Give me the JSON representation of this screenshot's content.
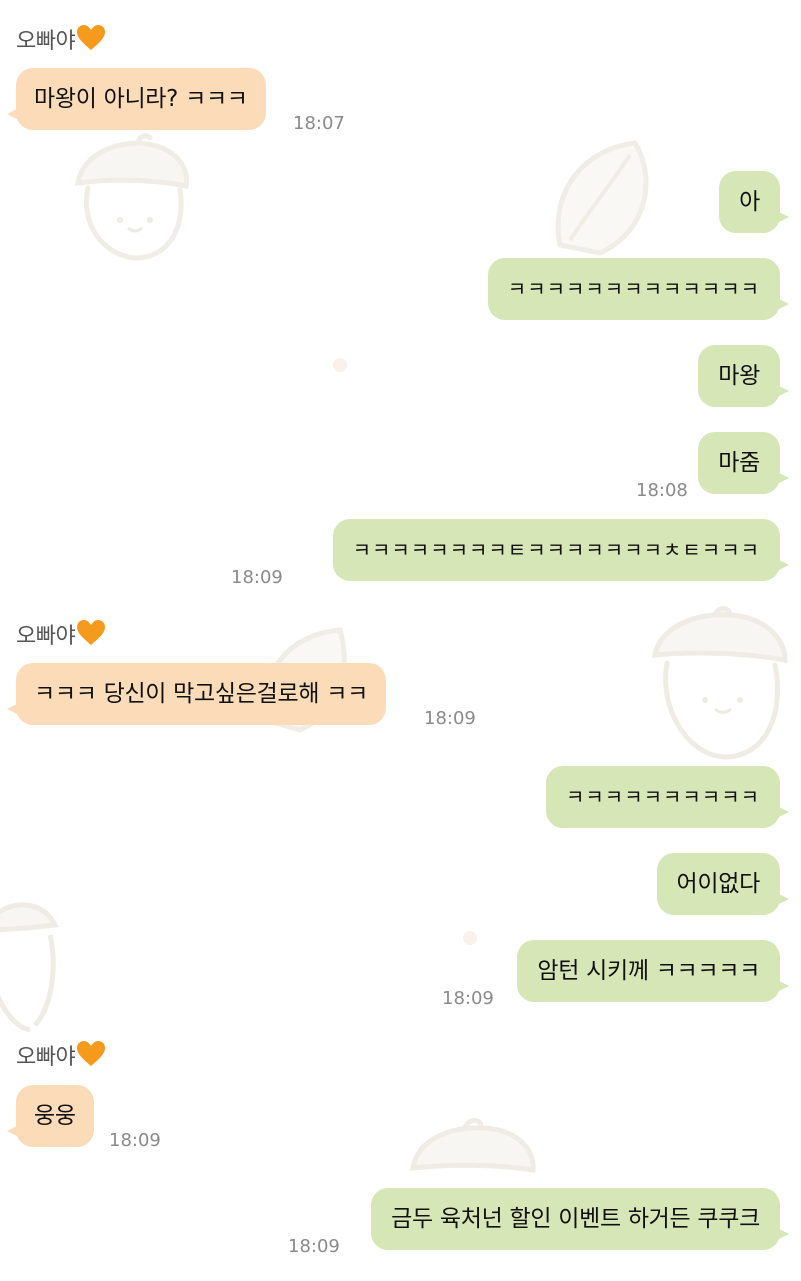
{
  "messages": [
    {
      "side": "in",
      "sender": "오빠야",
      "sender_emoji": "heart-icon",
      "text": "마왕이 아니라? ㅋㅋㅋ",
      "time": "18:07"
    },
    {
      "side": "out",
      "text": "아",
      "time": ""
    },
    {
      "side": "out",
      "text": "ㅋㅋㅋㅋㅋㅋㅋㅋㅋㅋㅋㅋㅋ",
      "time": ""
    },
    {
      "side": "out",
      "text": "마왕",
      "time": ""
    },
    {
      "side": "out",
      "text": "마줌",
      "time": "18:08"
    },
    {
      "side": "out",
      "text": "ㅋㅋㅋㅋㅋㅋㅋㅋㅌㅋㅋㅋㅋㅋㅋㅋㅊㅌㅋㅋㅋ",
      "time": "18:09"
    },
    {
      "side": "in",
      "sender": "오빠야",
      "sender_emoji": "heart-icon",
      "text": "ㅋㅋㅋ 당신이 막고싶은걸로해 ㅋㅋ",
      "time": "18:09"
    },
    {
      "side": "out",
      "text": "ㅋㅋㅋㅋㅋㅋㅋㅋㅋㅋ",
      "time": ""
    },
    {
      "side": "out",
      "text": "어이없다",
      "time": ""
    },
    {
      "side": "out",
      "text": "암턴 시키께 ㅋㅋㅋㅋㅋ",
      "time": "18:09"
    },
    {
      "side": "in",
      "sender": "오빠야",
      "sender_emoji": "heart-icon",
      "text": "웅웅",
      "time": "18:09"
    },
    {
      "side": "out",
      "text": "금두 육처넌 할인 이벤트 하거든 쿠쿠크",
      "time": "18:09"
    }
  ],
  "colors": {
    "incoming_bubble": "#fcdcb8",
    "outgoing_bubble": "#d6e6b7",
    "timestamp": "#8a8a8a",
    "background": "#ffffff"
  }
}
